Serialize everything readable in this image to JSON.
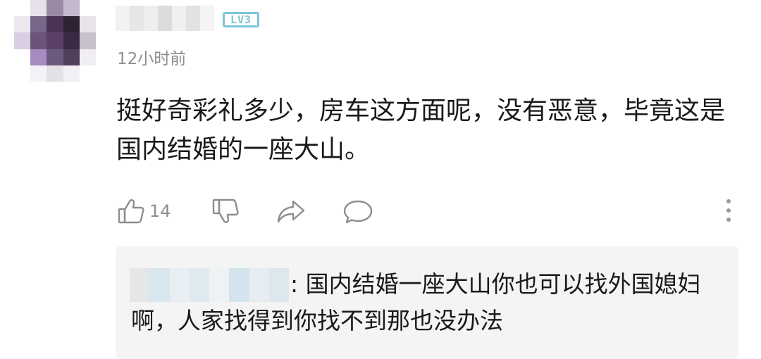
{
  "comment": {
    "level_badge": "LV3",
    "timestamp": "12小时前",
    "text": "挺好奇彩礼多少，房车这方面呢，没有恶意，毕竟这是国内结婚的一座大山。",
    "like_count": "14"
  },
  "reply": {
    "separator": ":",
    "text": ": 国内结婚一座大山你也可以找外国媳妇啊，人家找得到你找不到那也没办法"
  },
  "icons": [
    "like-icon",
    "dislike-icon",
    "share-icon",
    "reply-icon",
    "more-icon"
  ],
  "colors": {
    "text": "#1a1a1a",
    "meta": "#8e8e8e",
    "badge": "#7cc6d6",
    "reply_background": "#f4f4f4"
  }
}
